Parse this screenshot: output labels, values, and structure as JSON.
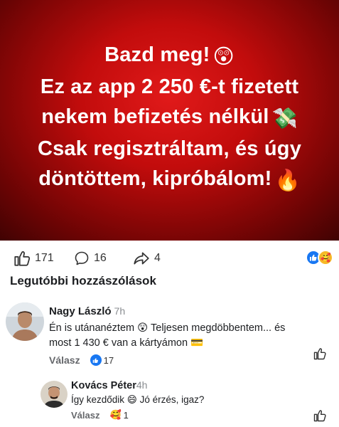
{
  "post": {
    "lines": [
      "Bazd meg!",
      "Ez az app 2 250 €-t fizetett",
      "nekem befizetés nélkül",
      "Csak regisztráltam, és úgy",
      "döntöttem, kipróbálom!"
    ],
    "emojis": [
      "😲",
      "💸",
      "🔥"
    ]
  },
  "stats": {
    "likes": "171",
    "comments": "16",
    "shares": "4"
  },
  "comments_section": {
    "title": "Legutóbbi hozzászólások"
  },
  "comments": [
    {
      "author": "Nagy László",
      "time": "7h",
      "text_line1": "Én is utánanéztem 😲 Teljesen megdöbbentem... és",
      "text_line2": "most 1 430 € van a kártyámon 💳",
      "reply_label": "Válasz",
      "reaction_count": "17"
    },
    {
      "author": "Kovács Péter",
      "time": "4h",
      "text": "Így kezdődik 😄 Jó érzés, igaz?",
      "reply_label": "Válasz",
      "reaction_count": "1"
    }
  ],
  "colors": {
    "hero_red": "#c20c0c",
    "like_blue": "#1877f2",
    "text_gray": "#65676b"
  }
}
